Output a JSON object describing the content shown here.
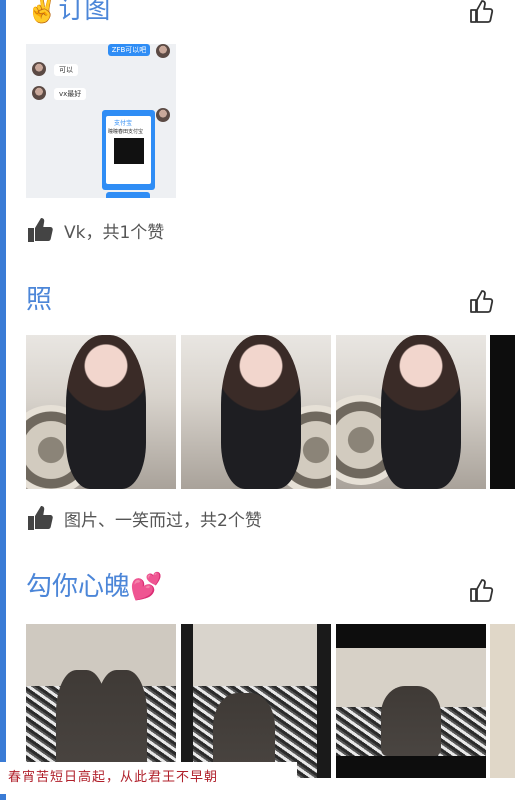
{
  "posts": [
    {
      "title": "✌️订图",
      "likes_text": "Vk，共1个赞",
      "chat": {
        "bubble_top": "ZFB可以吧",
        "msg1": "可以",
        "msg2": "vx最好",
        "pay_label": "支付宝",
        "pay_caption": "瞳瞳春田支付宝"
      }
    },
    {
      "title": "照",
      "likes_text": "图片、一笑而过，共2个赞"
    },
    {
      "title": "勾你心魄💕",
      "likes_text": ""
    }
  ],
  "watermark": "春宵苦短日高起，从此君王不早朝",
  "bottom_partial": "",
  "colors": {
    "title": "#4c86d8",
    "rail": "#3a7bd5",
    "watermark": "#b0202b"
  },
  "icons": [
    "thumbs-up-outline-icon",
    "thumbs-up-filled-icon"
  ]
}
